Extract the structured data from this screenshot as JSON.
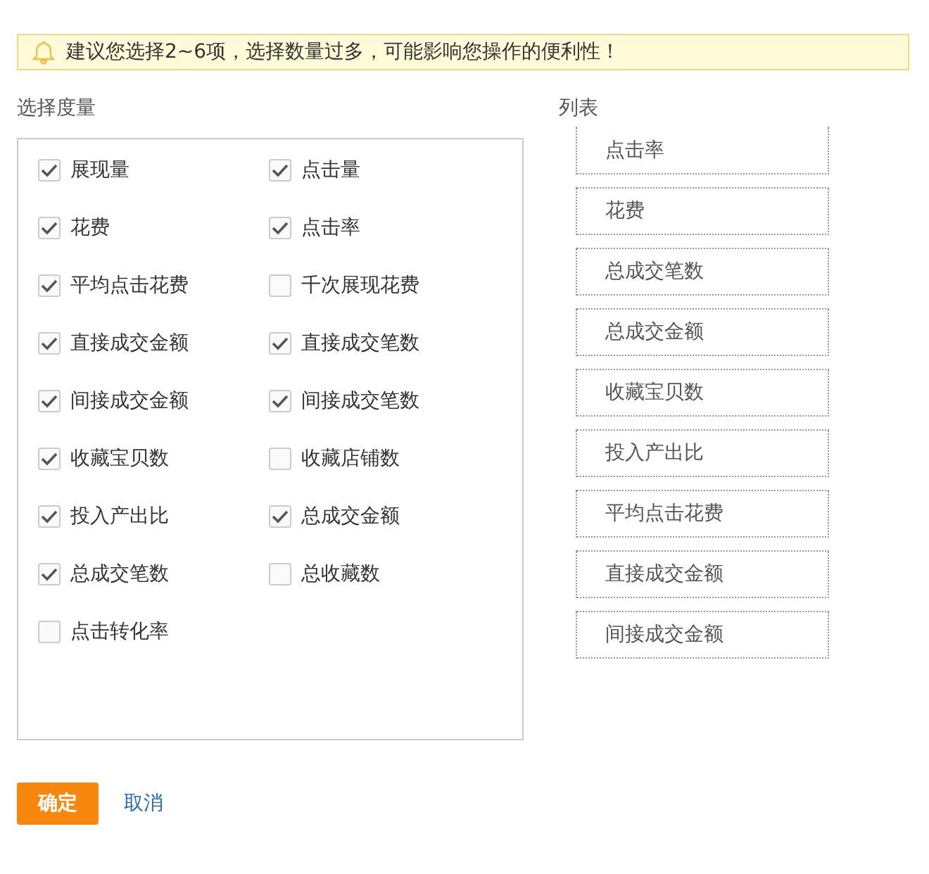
{
  "notice": {
    "text": "建议您选择2~6项，选择数量过多，可能影响您操作的便利性！"
  },
  "metrics": {
    "title": "选择度量",
    "items": [
      {
        "label": "展现量",
        "checked": true
      },
      {
        "label": "点击量",
        "checked": true
      },
      {
        "label": "花费",
        "checked": true
      },
      {
        "label": "点击率",
        "checked": true
      },
      {
        "label": "平均点击花费",
        "checked": true
      },
      {
        "label": "千次展现花费",
        "checked": false
      },
      {
        "label": "直接成交金额",
        "checked": true
      },
      {
        "label": "直接成交笔数",
        "checked": true
      },
      {
        "label": "间接成交金额",
        "checked": true
      },
      {
        "label": "间接成交笔数",
        "checked": true
      },
      {
        "label": "收藏宝贝数",
        "checked": true
      },
      {
        "label": "收藏店铺数",
        "checked": false
      },
      {
        "label": "投入产出比",
        "checked": true
      },
      {
        "label": "总成交金额",
        "checked": true
      },
      {
        "label": "总成交笔数",
        "checked": true
      },
      {
        "label": "总收藏数",
        "checked": false
      },
      {
        "label": "点击转化率",
        "checked": false
      }
    ]
  },
  "list": {
    "title": "列表",
    "items": [
      "点击率",
      "花费",
      "总成交笔数",
      "总成交金额",
      "收藏宝贝数",
      "投入产出比",
      "平均点击花费",
      "直接成交金额",
      "间接成交金额"
    ]
  },
  "buttons": [
    {
      "label": "确定",
      "kind": "primary"
    },
    {
      "label": "取消",
      "kind": "link"
    }
  ]
}
